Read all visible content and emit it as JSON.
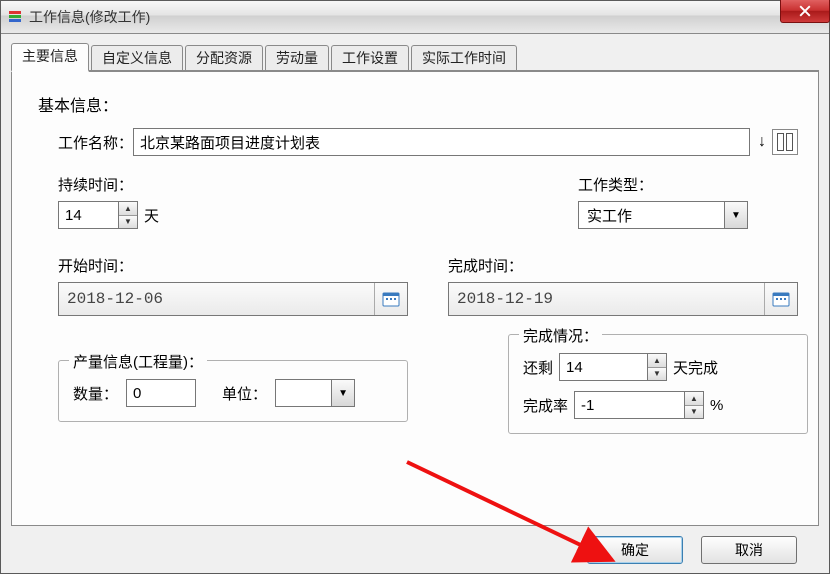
{
  "window": {
    "title": "工作信息(修改工作)"
  },
  "tabs": [
    "主要信息",
    "自定义信息",
    "分配资源",
    "劳动量",
    "工作设置",
    "实际工作时间"
  ],
  "section": {
    "basic": "基本信息："
  },
  "name": {
    "label": "工作名称：",
    "value": "北京某路面项目进度计划表"
  },
  "duration": {
    "label": "持续时间：",
    "value": "14",
    "unit": "天"
  },
  "type": {
    "label": "工作类型：",
    "value": "实工作"
  },
  "start": {
    "label": "开始时间：",
    "value": "2018-12-06"
  },
  "finish": {
    "label": "完成时间：",
    "value": "2018-12-19"
  },
  "output": {
    "group": "产量信息(工程量)：",
    "qty_label": "数量：",
    "qty_value": "0",
    "unit_label": "单位：",
    "unit_value": ""
  },
  "completion": {
    "group": "完成情况：",
    "remain_label": "还剩",
    "remain_value": "14",
    "remain_unit": "天完成",
    "rate_label": "完成率",
    "rate_value": "-1",
    "rate_unit": "%"
  },
  "buttons": {
    "ok": "确定",
    "cancel": "取消"
  }
}
